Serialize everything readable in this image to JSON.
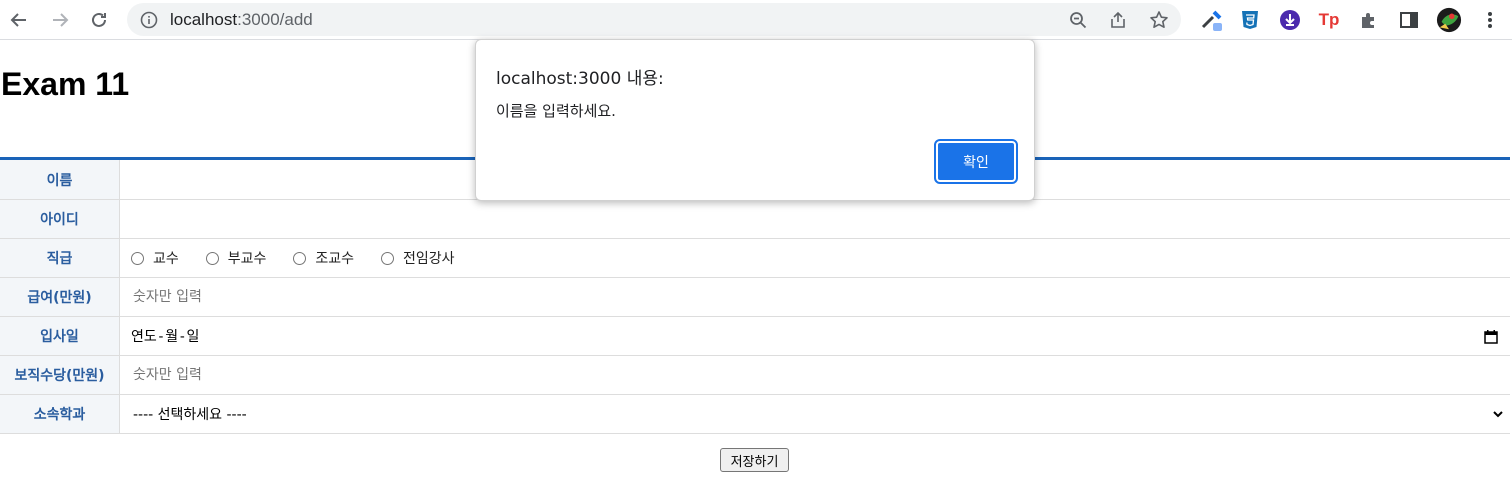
{
  "browser": {
    "url_host": "localhost",
    "url_path": ":3000/add",
    "icons": [
      "back-icon",
      "forward-icon",
      "reload-icon",
      "info-icon",
      "zoom-icon",
      "share-icon",
      "bookmark-star-icon",
      "eyedropper-extension-icon",
      "css-extension-icon",
      "download-extension-icon",
      "tp-extension-icon",
      "puzzle-extensions-icon",
      "side-panel-icon",
      "profile-avatar-icon",
      "menu-dots-icon"
    ],
    "tp_label": "Tp"
  },
  "page": {
    "title": "Exam 11"
  },
  "form": {
    "rows": [
      {
        "label": "이름"
      },
      {
        "label": "아이디"
      },
      {
        "label": "직급"
      },
      {
        "label": "급여(만원)",
        "placeholder": "숫자만 입력"
      },
      {
        "label": "입사일",
        "value": "연도-월-일"
      },
      {
        "label": "보직수당(만원)",
        "placeholder": "숫자만 입력"
      },
      {
        "label": "소속학과",
        "selected": "---- 선택하세요 ----"
      }
    ],
    "positions": [
      "교수",
      "부교수",
      "조교수",
      "전임강사"
    ],
    "save_label": "저장하기"
  },
  "dialog": {
    "title": "localhost:3000 내용:",
    "message": "이름을 입력하세요.",
    "ok_label": "확인"
  },
  "colors": {
    "accent_border": "#1a63b8",
    "label_text": "#2a5d9f",
    "dialog_button": "#1a73e8"
  }
}
